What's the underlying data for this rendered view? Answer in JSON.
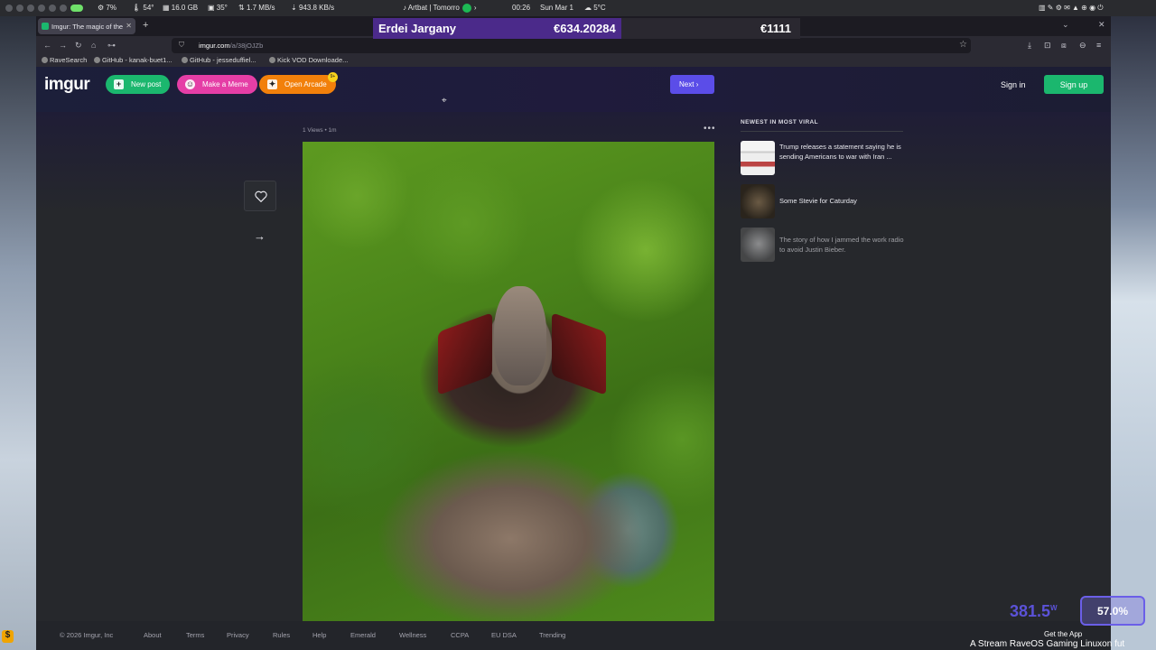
{
  "os_bar": {
    "cpu": "7%",
    "cpu_temp": "54°",
    "memory": "16.0 GB",
    "gpu_temp": "35°",
    "net_up": "1.7 MB/s",
    "net_down": "943.8 KB/s",
    "now_playing": "Artbat | Tomorro",
    "time": "00:26",
    "date": "Sun Mar 1",
    "weather": "5°C"
  },
  "browser": {
    "tab_title": "Imgur: The magic of the",
    "url_host": "imgur.com",
    "url_path": "/a/38jOJZb",
    "bookmarks": [
      "RaveSearch",
      "GitHub - kanak-buet1...",
      "GitHub - jesseduffiel...",
      "Kick VOD Downloade..."
    ]
  },
  "stream_overlay": {
    "name": "Erdei Jargany",
    "amount": "€634.20284",
    "total": "€1111",
    "watt_value": "381.5",
    "watt_unit": "W",
    "percent": "57.0%",
    "ticker": "A Stream RaveOS Gaming Linuxon fut"
  },
  "imgur": {
    "logo": "imgur",
    "new_post": "New post",
    "make_meme": "Make a Meme",
    "open_arcade": "Open Arcade",
    "arcade_badge": "9+",
    "next": "Next",
    "sign_in": "Sign in",
    "sign_up": "Sign up",
    "post_meta": "1 Views • 1m",
    "sidebar": {
      "title": "NEWEST IN MOST VIRAL",
      "items": [
        {
          "title": "Trump releases a statement saying he is sending Americans to war with Iran ..."
        },
        {
          "title": "Some Stevie for Caturday"
        },
        {
          "title": "The story of how I jammed the work radio to avoid Justin Bieber."
        }
      ]
    },
    "footer": {
      "copyright": "© 2026 Imgur, Inc",
      "links": [
        "About",
        "Terms",
        "Privacy",
        "Rules",
        "Help",
        "Emerald",
        "Wellness",
        "CCPA",
        "EU DSA",
        "Trending"
      ],
      "get_app": "Get the App"
    }
  },
  "colors": {
    "imgur_green": "#1bb76e",
    "meme_pink": "#e53ea6",
    "arcade_orange": "#f2800b",
    "next_purple": "#5b4de8"
  }
}
